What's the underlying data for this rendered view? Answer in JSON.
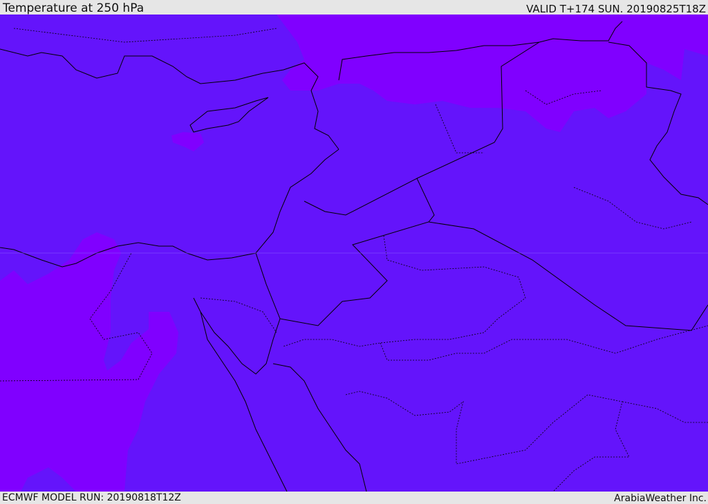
{
  "header": {
    "title": "Temperature at 250 hPa",
    "valid": "VALID T+174 SUN. 20190825T18Z"
  },
  "footer": {
    "model_run": "ECMWF MODEL RUN: 20190818T12Z",
    "credit": "ArabiaWeather Inc."
  },
  "colors": {
    "base_field": "#6414fb",
    "warm_field": "#8000ff",
    "header_bg": "#e6e6e6"
  }
}
